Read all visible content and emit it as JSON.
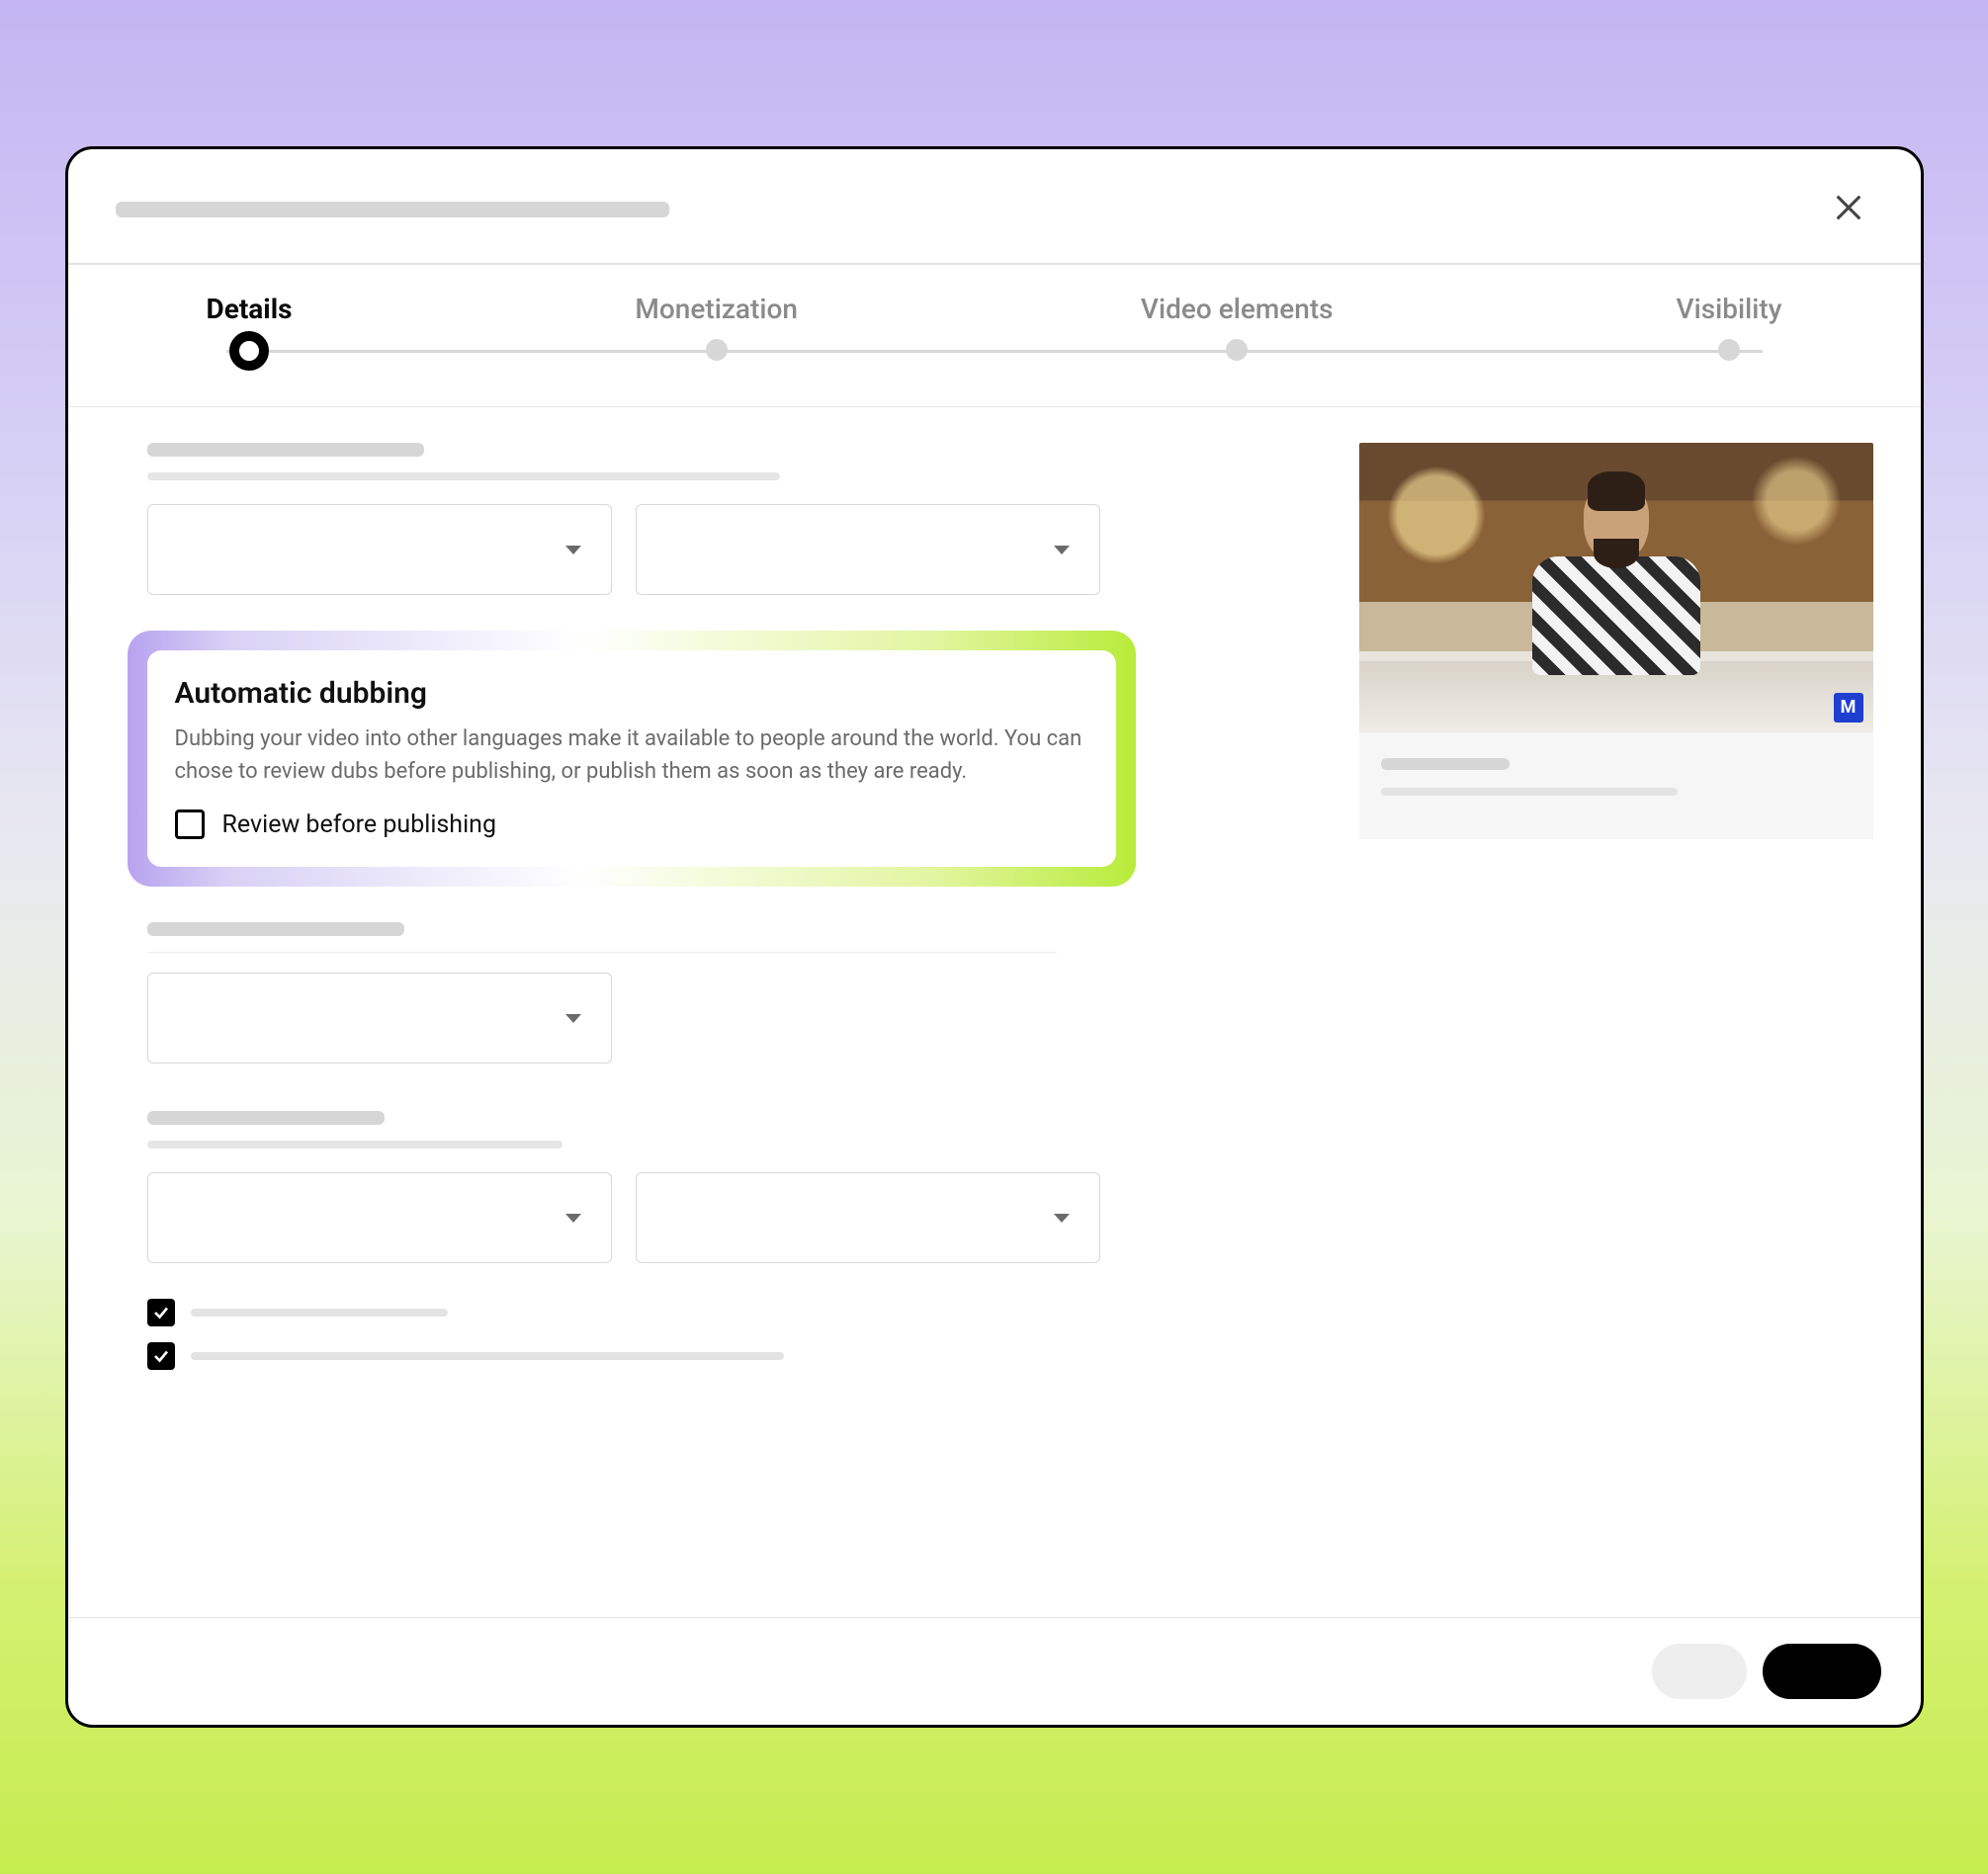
{
  "stepper": {
    "steps": [
      {
        "label": "Details",
        "active": true
      },
      {
        "label": "Monetization",
        "active": false
      },
      {
        "label": "Video elements",
        "active": false
      },
      {
        "label": "Visibility",
        "active": false
      }
    ]
  },
  "highlight": {
    "title": "Automatic dubbing",
    "description": "Dubbing your video into other languages make it available to people around the world. You can chose to review dubs before publishing, or publish them as soon as they are ready.",
    "checkbox_label": "Review before publishing",
    "checkbox_checked": false
  },
  "thumbnail": {
    "badge": "M"
  },
  "bottom_checks": [
    {
      "checked": true
    },
    {
      "checked": true
    }
  ]
}
